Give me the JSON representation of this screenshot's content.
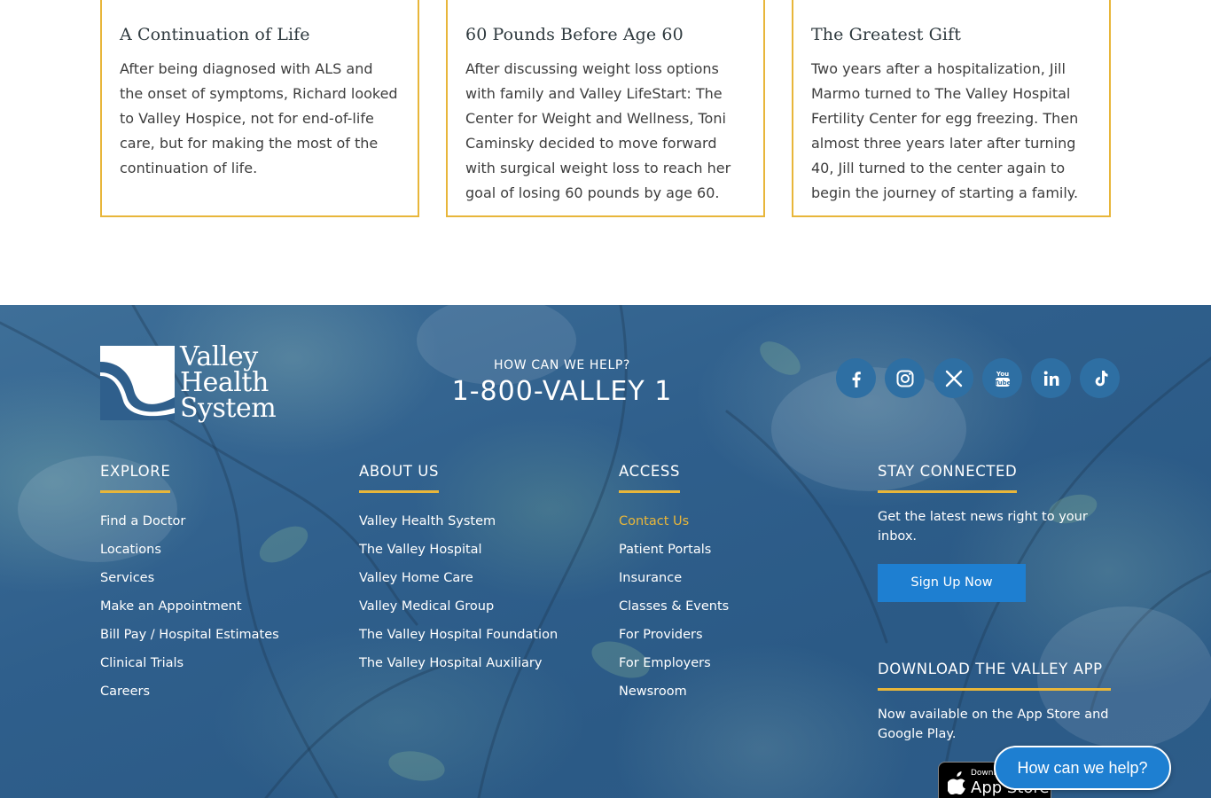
{
  "stories": [
    {
      "title": "A Continuation of Life",
      "body": "After being diagnosed with ALS and the onset of symptoms, Richard looked to Valley Hospice, not for end-of-life care, but for making the most of the continuation of life."
    },
    {
      "title": "60 Pounds Before Age 60",
      "body": "After discussing weight loss options with family and Valley LifeStart: The Center for Weight and Wellness, Toni Caminsky decided to move forward with surgical weight loss to reach her goal of losing 60 pounds by age 60."
    },
    {
      "title": "The Greatest Gift",
      "body": "Two years after a hospitalization, Jill Marmo turned to The Valley Hospital Fertility Center for egg freezing. Then almost three years later after turning 40, Jill turned to the center again to begin the journey of starting a family."
    }
  ],
  "footer": {
    "logo": {
      "line1": "Valley",
      "line2": "Health",
      "line3": "System"
    },
    "help_label": "HOW CAN WE HELP?",
    "phone": "1-800-VALLEY 1",
    "social": [
      {
        "icon": "facebook-icon"
      },
      {
        "icon": "instagram-icon"
      },
      {
        "icon": "x-twitter-icon"
      },
      {
        "icon": "youtube-icon"
      },
      {
        "icon": "linkedin-icon"
      },
      {
        "icon": "tiktok-icon"
      }
    ],
    "explore": {
      "heading": "EXPLORE",
      "links": [
        "Find a Doctor",
        "Locations",
        "Services",
        "Make an Appointment",
        "Bill Pay / Hospital Estimates",
        "Clinical Trials",
        "Careers"
      ]
    },
    "about": {
      "heading": "ABOUT US",
      "links": [
        "Valley Health System",
        "The Valley Hospital",
        "Valley Home Care",
        "Valley Medical Group",
        "The Valley Hospital Foundation",
        "The Valley Hospital Auxiliary"
      ]
    },
    "access": {
      "heading": "ACCESS",
      "links": [
        "Contact Us",
        "Patient Portals",
        "Insurance",
        "Classes & Events",
        "For Providers",
        "For Employers",
        "Newsroom"
      ]
    },
    "connected": {
      "heading": "STAY CONNECTED",
      "text": "Get the latest news right to your inbox.",
      "button": "Sign Up Now",
      "app_heading": "DOWNLOAD THE VALLEY APP",
      "app_text": "Now available on the App Store and Google Play.",
      "appstore_small": "Download on the",
      "appstore_big": "App Store"
    }
  },
  "chat_button": "How can we help?",
  "colors": {
    "accent_gold": "#e8b63a",
    "button_blue": "#1e7fd1",
    "footer_blue": "#2f5f8c"
  }
}
